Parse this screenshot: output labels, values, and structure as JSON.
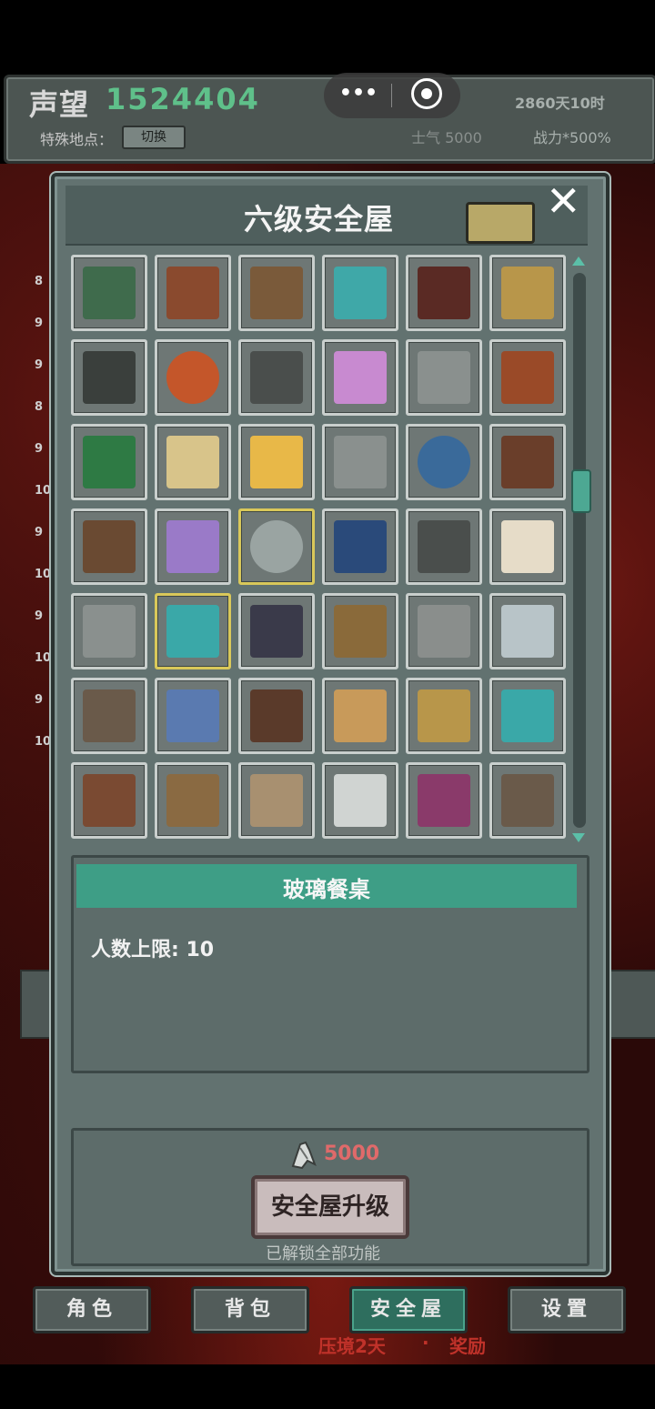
{
  "top_bar": {
    "reputation_label": "声望",
    "reputation_value": "1524404",
    "special_location_label": "特殊地点：",
    "switch_label": "切换",
    "days": "2860天10时",
    "morale": "士气 5000",
    "power": "战力*500%"
  },
  "system_capsule": {
    "more_label": "•••"
  },
  "side_numbers": [
    "8",
    "9",
    "9",
    "8",
    "9",
    "10",
    "9",
    "10",
    "9",
    "10",
    "9",
    "10"
  ],
  "panel": {
    "title": "六级安全屋",
    "close_label": "✕",
    "selected_item": {
      "name": "玻璃餐桌",
      "capacity_text": "人数上限: 10"
    },
    "upgrade": {
      "cost": "5000",
      "button_label": "安全屋升级",
      "note": "已解锁全部功能"
    }
  },
  "items": [
    {
      "name": "control-panel",
      "color": "#3f6b4c"
    },
    {
      "name": "crafting-table",
      "color": "#8a4a2e"
    },
    {
      "name": "shelf-board",
      "color": "#7a5a3a"
    },
    {
      "name": "fish-tank",
      "color": "#3fa8a8"
    },
    {
      "name": "rug-bed",
      "color": "#5a2a24"
    },
    {
      "name": "garden-mat",
      "color": "#b8964a"
    },
    {
      "name": "control-panel-2",
      "color": "#3a3f3c"
    },
    {
      "name": "basketball",
      "color": "#c4562a"
    },
    {
      "name": "vent-grill",
      "color": "#4a4e4c"
    },
    {
      "name": "arcade-machine",
      "color": "#c88ad0"
    },
    {
      "name": "engine-machine",
      "color": "#8a908e"
    },
    {
      "name": "work-table",
      "color": "#9a4a28"
    },
    {
      "name": "pool-table",
      "color": "#2e7a44"
    },
    {
      "name": "radio",
      "color": "#d8c48a"
    },
    {
      "name": "bean-bag",
      "color": "#e8b848"
    },
    {
      "name": "engine-machine-2",
      "color": "#8a908e"
    },
    {
      "name": "round-sign",
      "color": "#3a6a9a"
    },
    {
      "name": "piano",
      "color": "#6a3e2a"
    },
    {
      "name": "toy-box",
      "color": "#6a4a32"
    },
    {
      "name": "sofa-mat",
      "color": "#9a7ac8"
    },
    {
      "name": "glass-table",
      "color": "#9aa4a2"
    },
    {
      "name": "arcade-cabinet",
      "color": "#2a4a7a"
    },
    {
      "name": "vent-grill-2",
      "color": "#4a4e4c"
    },
    {
      "name": "bed",
      "color": "#e6dcc8"
    },
    {
      "name": "engine-machine-3",
      "color": "#8a908e"
    },
    {
      "name": "sewing-table",
      "color": "#3aa8a8"
    },
    {
      "name": "hero-figure",
      "color": "#3a3a4a"
    },
    {
      "name": "bookshelf",
      "color": "#8a6a3a"
    },
    {
      "name": "robot",
      "color": "#8a8e8c"
    },
    {
      "name": "lab-bench",
      "color": "#b8c4c8"
    },
    {
      "name": "dining-table-small",
      "color": "#6a5a4a"
    },
    {
      "name": "gamepad",
      "color": "#5a7ab0"
    },
    {
      "name": "drawer-cabinet",
      "color": "#5a3a2a"
    },
    {
      "name": "kitchen-counter",
      "color": "#c89a5a"
    },
    {
      "name": "garden-mat-2",
      "color": "#b8964a"
    },
    {
      "name": "sewing-table-2",
      "color": "#3aa8a8"
    },
    {
      "name": "tv-stand",
      "color": "#7a4a32"
    },
    {
      "name": "rug-frame",
      "color": "#8a6a42"
    },
    {
      "name": "bed-2",
      "color": "#a89070"
    },
    {
      "name": "desk-plants",
      "color": "#d0d4d2"
    },
    {
      "name": "control-panel-3",
      "color": "#8a3a6a"
    },
    {
      "name": "dining-table-long",
      "color": "#6a5a4a"
    }
  ],
  "selected_index": 20,
  "highlight_index": 25,
  "nav": {
    "role": "角色",
    "bag": "背包",
    "safehouse": "安全屋",
    "settings": "设置"
  },
  "status": {
    "pressure": "压境2天",
    "separator": "·",
    "reward": "奖励"
  },
  "colors": {
    "accent": "#3e9e86",
    "reputation": "#5fc08a",
    "cost": "#e06a6a",
    "alert": "#c0322a"
  }
}
